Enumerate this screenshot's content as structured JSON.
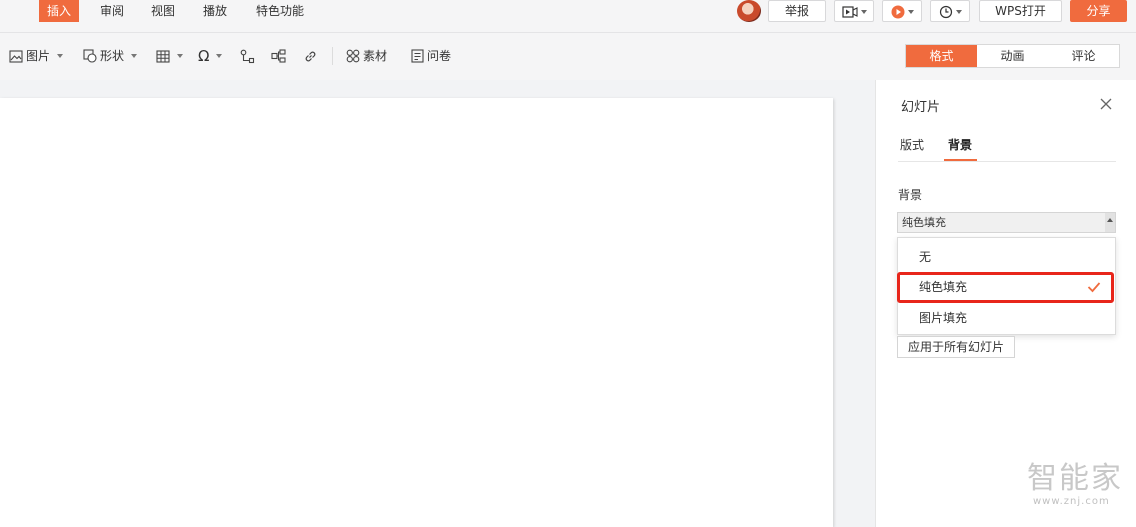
{
  "menu": {
    "items": [
      {
        "label": "插入",
        "active": true
      },
      {
        "label": "审阅",
        "active": false
      },
      {
        "label": "视图",
        "active": false
      },
      {
        "label": "播放",
        "active": false
      },
      {
        "label": "特色功能",
        "active": false
      }
    ]
  },
  "topright": {
    "report_label": "举报",
    "open_label": "WPS打开",
    "share_label": "分享"
  },
  "toolbar": {
    "picture": "图片",
    "shape": "形状",
    "material": "素材",
    "survey": "问卷"
  },
  "right_tabs": [
    {
      "label": "格式",
      "active": true
    },
    {
      "label": "动画",
      "active": false
    },
    {
      "label": "评论",
      "active": false
    }
  ],
  "panel": {
    "title": "幻灯片",
    "tabs": [
      {
        "label": "版式",
        "active": false
      },
      {
        "label": "背景",
        "active": true
      }
    ],
    "section_label": "背景",
    "select_value": "纯色填充",
    "options": [
      {
        "label": "无",
        "selected": false
      },
      {
        "label": "纯色填充",
        "selected": true
      },
      {
        "label": "图片填充",
        "selected": false
      }
    ],
    "apply_all_label": "应用于所有幻灯片"
  },
  "watermark": {
    "brand": "智能家",
    "url": "www.znj.com"
  },
  "colors": {
    "accent": "#f06b3e",
    "highlight_box": "#e8261b"
  }
}
